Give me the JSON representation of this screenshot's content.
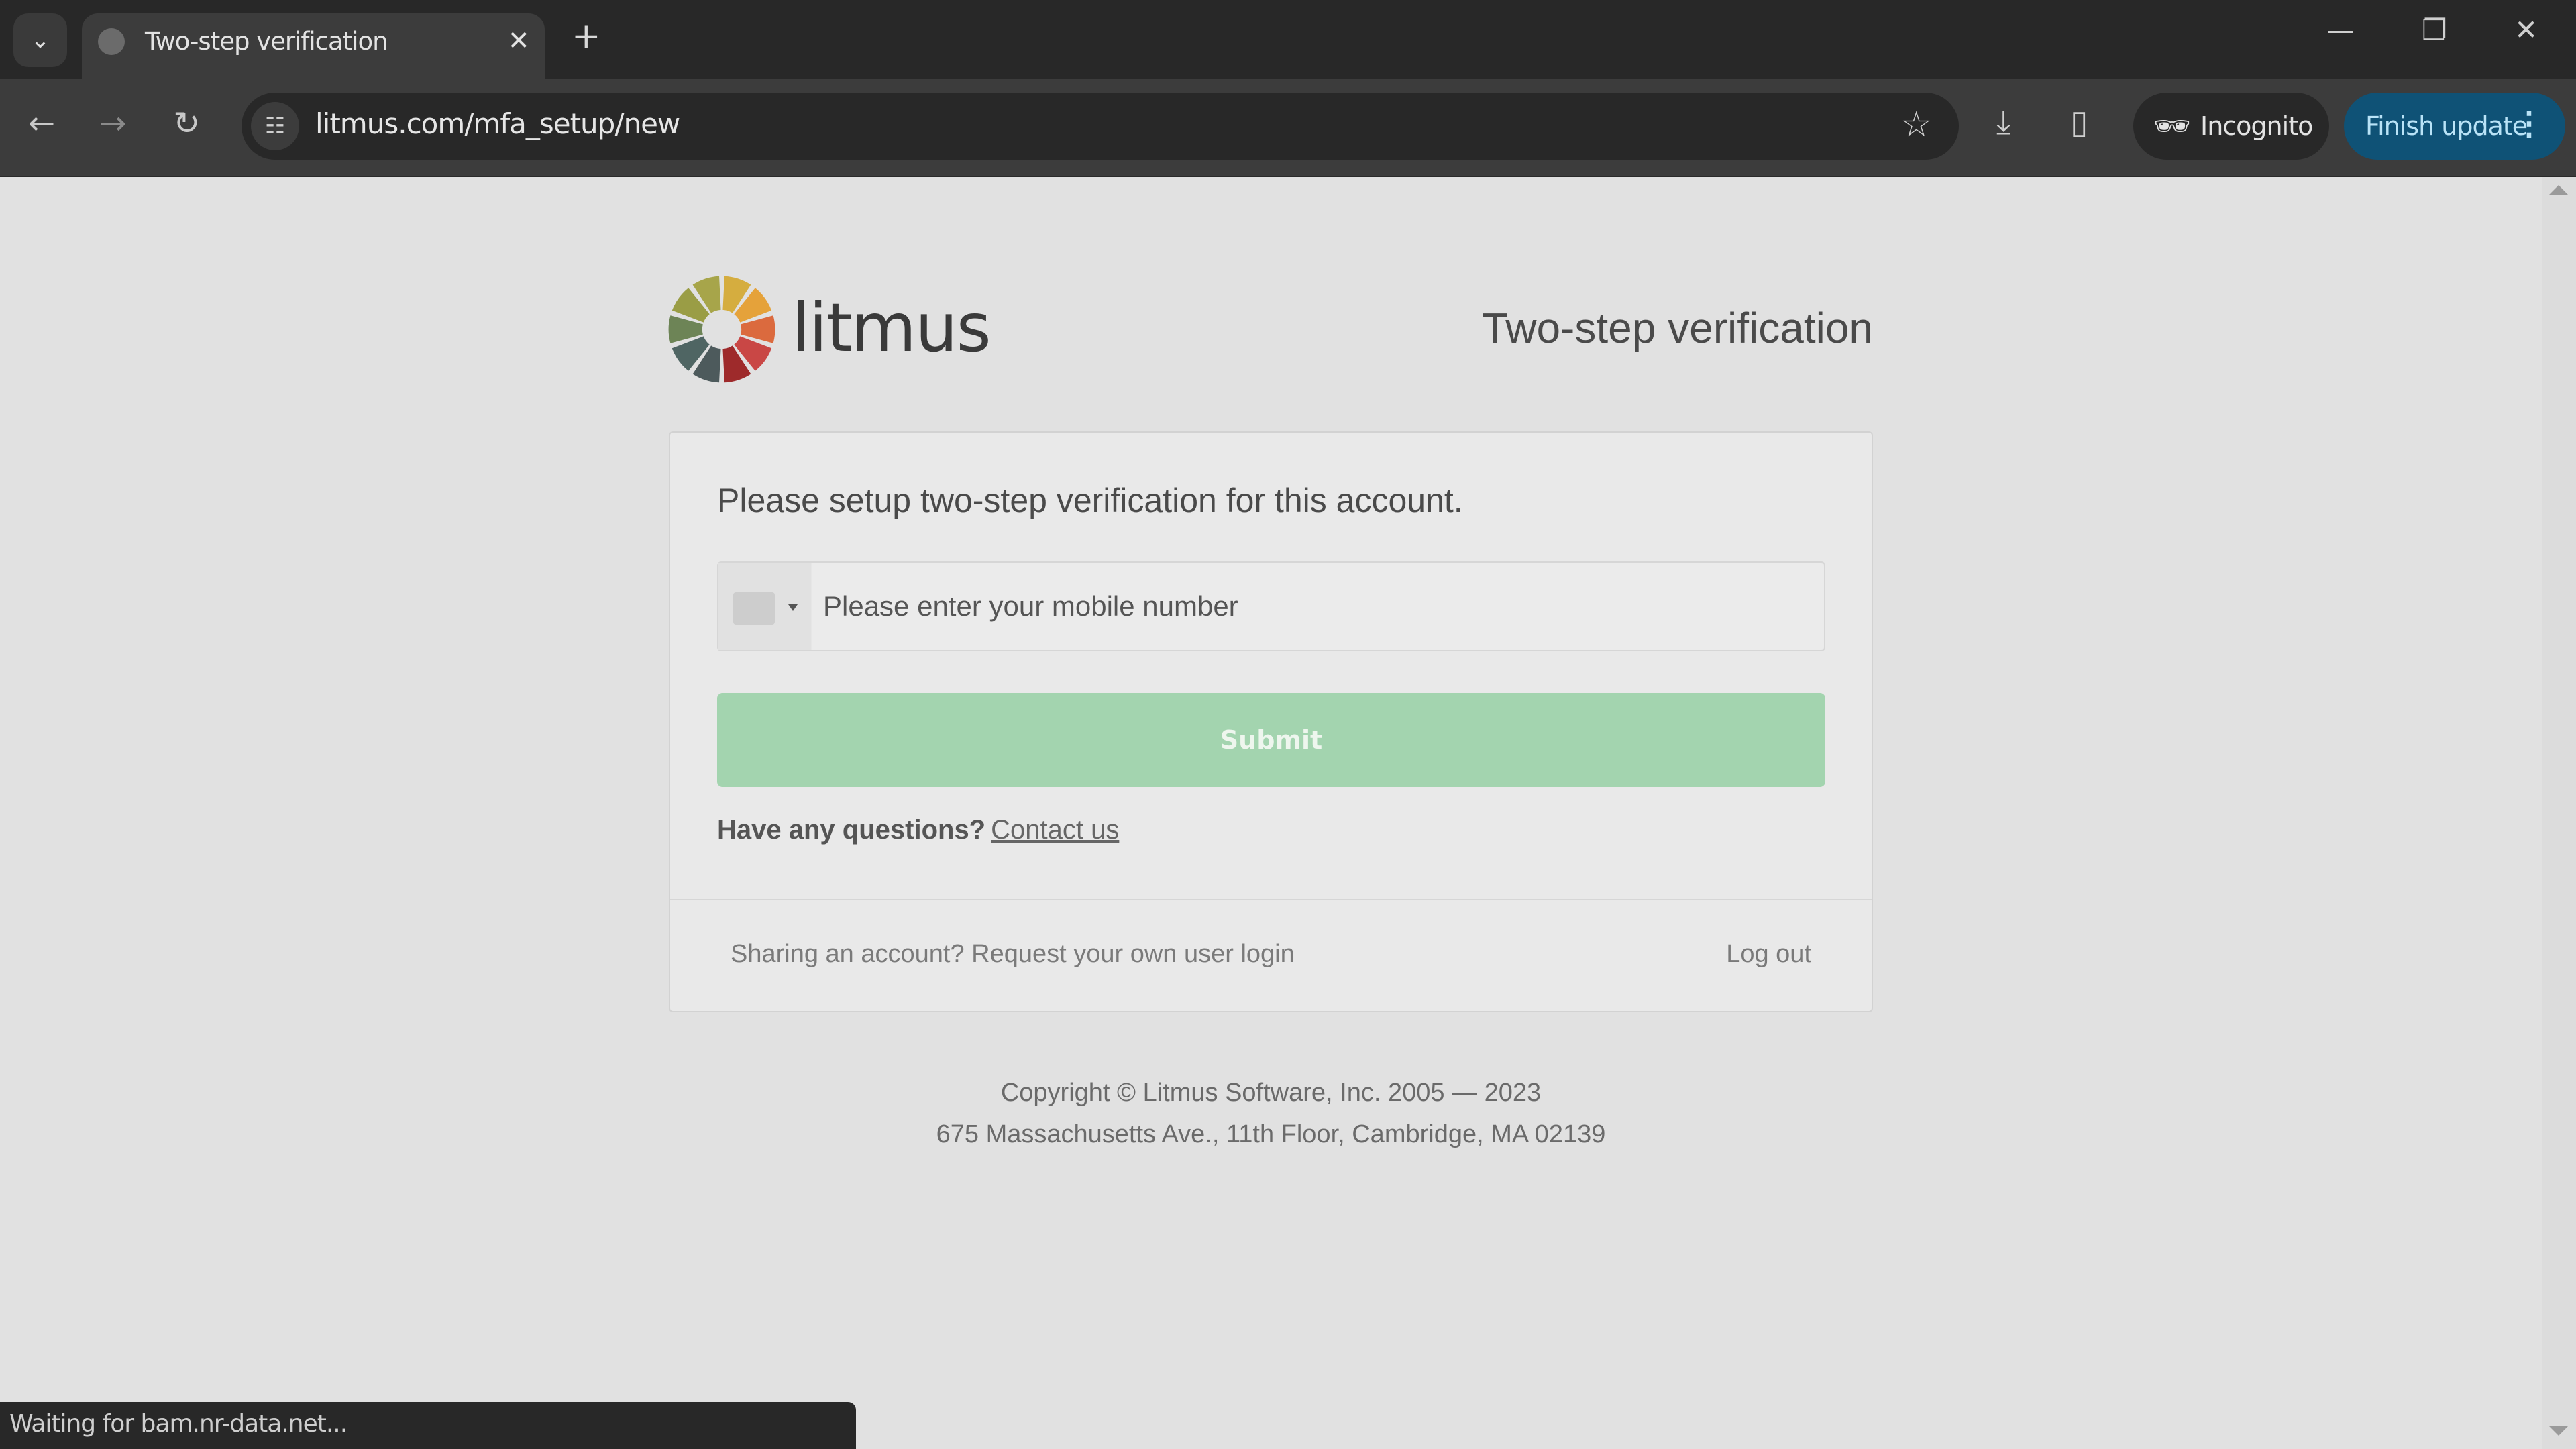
{
  "browser": {
    "tab": {
      "title": "Two-step verification",
      "close_icon": "close-icon",
      "favicon": "globe-icon"
    },
    "new_tab_icon": "plus-icon",
    "tab_list_icon": "chevron-down-icon",
    "window_controls": {
      "minimize": "—",
      "restore": "❐",
      "close": "✕"
    },
    "nav": {
      "back": "←",
      "forward": "→",
      "reload": "↻"
    },
    "address_bar": {
      "url": "litmus.com/mfa_setup/new",
      "site_info_icon": "tune-icon"
    },
    "bookmark_icon": "☆",
    "download_icon": "⤓",
    "side_panel_icon": "▯",
    "incognito": {
      "label": "Incognito",
      "icon": "🕶"
    },
    "finish_update": {
      "label": "Finish update",
      "menu_icon": "⋮"
    },
    "colors": {
      "finish_update_bg": "#0f5276",
      "finish_update_text": "#b9e3f7"
    }
  },
  "page": {
    "logo": {
      "text": "litmus",
      "wheel_colors": [
        "#d5ad3f",
        "#e5a23a",
        "#db6a3e",
        "#c94745",
        "#9e2a2b",
        "#4d5a5c",
        "#4f6563",
        "#6d8456",
        "#9a9d45",
        "#a7a54a"
      ]
    },
    "heading": "Two-step verification",
    "card": {
      "message": "Please setup two-step verification for this account.",
      "phone": {
        "placeholder": "Please enter your mobile number",
        "value": ""
      },
      "submit_label": "Submit",
      "questions_label": "Have any questions?",
      "contact_label": "Contact us",
      "share_text": "Sharing an account? Request your own user login",
      "logout_label": "Log out"
    },
    "footer": {
      "copyright": "Copyright © Litmus Software, Inc. 2005 — 2023",
      "address": "675 Massachusetts Ave., 11th Floor, Cambridge, MA 02139"
    },
    "colors": {
      "submit_bg": "#a3d4af"
    }
  },
  "status": {
    "text": "Waiting for bam.nr-data.net..."
  }
}
